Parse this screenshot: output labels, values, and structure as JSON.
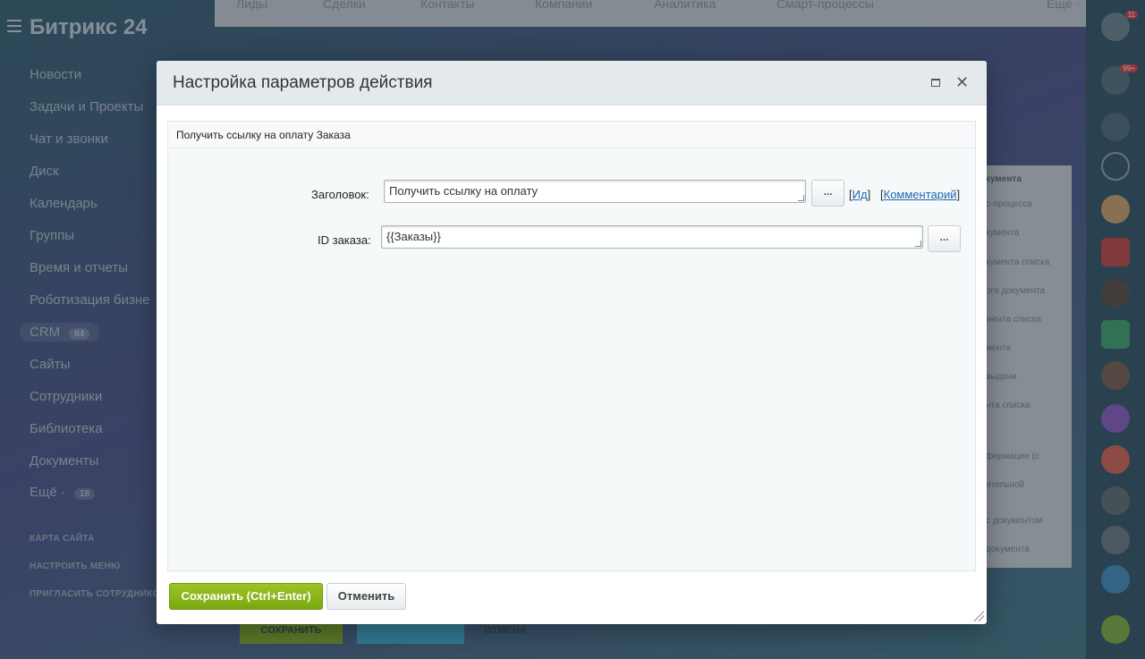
{
  "background": {
    "logo": "Битрикс",
    "logo_num": "24",
    "menu": [
      {
        "label": "Новости",
        "counter": null
      },
      {
        "label": "Задачи и Проекты",
        "counter": null
      },
      {
        "label": "Чат и звонки",
        "counter": null
      },
      {
        "label": "Диск",
        "counter": null
      },
      {
        "label": "Календарь",
        "counter": null
      },
      {
        "label": "Группы",
        "counter": null
      },
      {
        "label": "Время и отчеты",
        "counter": null
      },
      {
        "label": "Роботизация бизне",
        "counter": null
      },
      {
        "label": "CRM",
        "counter": "84"
      },
      {
        "label": "Сайты",
        "counter": null
      },
      {
        "label": "Сотрудники",
        "counter": null
      },
      {
        "label": "Библиотека",
        "counter": null
      },
      {
        "label": "Документы",
        "counter": null
      },
      {
        "label": "Ещё ·",
        "counter": "18"
      }
    ],
    "menu_small": [
      "КАРТА САЙТА",
      "НАСТРОИТЬ МЕНЮ",
      "ПРИГЛАСИТЬ СОТРУДНИКО"
    ],
    "top_tabs": [
      "Лиды",
      "Сделки",
      "Контакты",
      "Компании",
      "Аналитика",
      "Смарт-процессы",
      "Еще ·"
    ],
    "panel_header": "кумента",
    "panel_items": [
      "с-процесса",
      "кумента",
      "кумента списка",
      "ого документа",
      "мента списка",
      "мента",
      "выдачи",
      "нта списка",
      "формации (с",
      "ительной",
      "с документом",
      "документа"
    ],
    "bottom_buttons": [
      "СОХРАНИТЬ",
      "",
      "ОТМЕНА"
    ],
    "right_badges": [
      "11",
      "99+"
    ]
  },
  "dialog": {
    "title": "Настройка параметров действия",
    "section_title": "Получить ссылку на оплату Заказа",
    "fields": [
      {
        "label": "Заголовок:",
        "value": "Получить ссылку на оплату",
        "button": "..."
      },
      {
        "label": "ID заказа:",
        "value": "{{Заказы}}",
        "button": "..."
      }
    ],
    "links": {
      "id_label": "Ид",
      "comment_label": "Комментарий"
    },
    "save_label": "Сохранить (Ctrl+Enter)",
    "cancel_label": "Отменить"
  },
  "colors": {
    "accent_green": "#86b21a",
    "link": "#2067b0"
  }
}
